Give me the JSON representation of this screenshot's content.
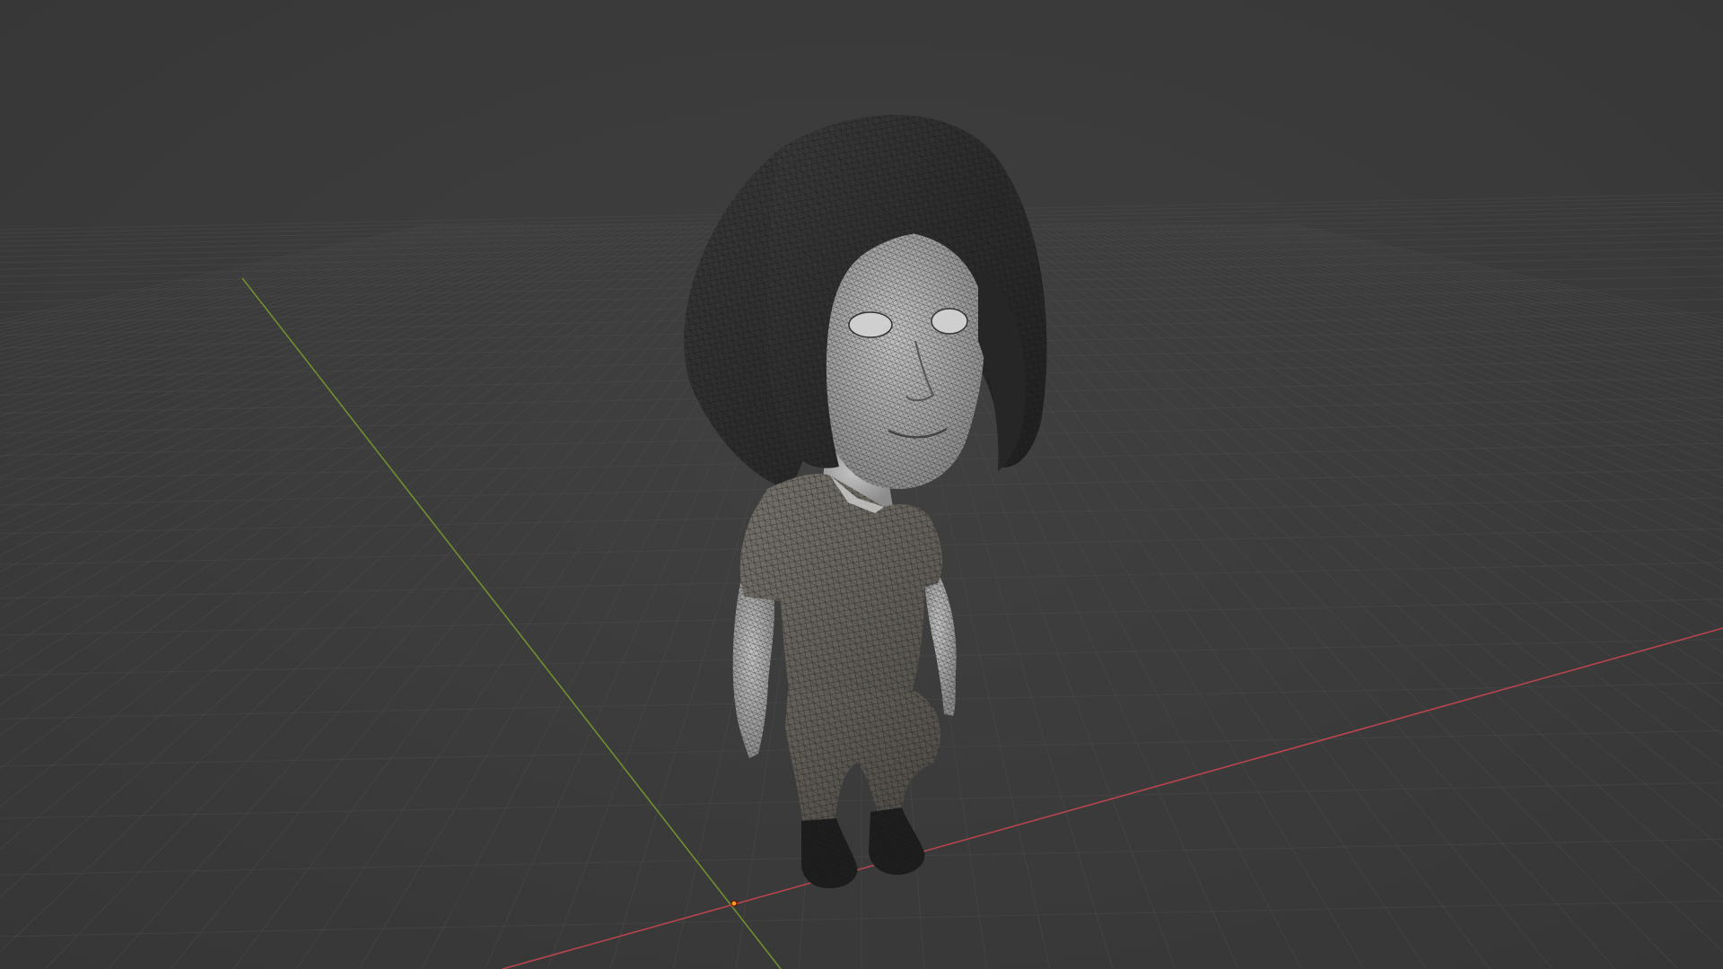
{
  "viewport": {
    "mode": "3d-viewport",
    "shading": "solid-wireframe-overlay",
    "background_color": "#3d3d3d",
    "grid_line_color": "#4b4b4b",
    "x_axis_color": "#b8444d",
    "y_axis_color": "#6f8f2e",
    "origin_marker_color": "#ff9a1f"
  },
  "object": {
    "name_icon": "character-mesh",
    "parts": [
      "hair",
      "head",
      "shirt",
      "arms",
      "pants",
      "boots"
    ],
    "colors": {
      "hair": "#2a2a2a",
      "skin": "#a8a8a8",
      "shirt": "#6a6660",
      "pants": "#5b5750",
      "boots": "#1c1c1c",
      "wire": "#1a1a1a"
    }
  }
}
